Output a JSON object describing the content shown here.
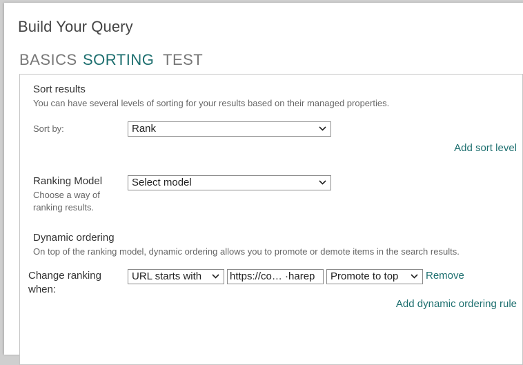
{
  "dialog": {
    "title": "Build Your Query"
  },
  "tabs": [
    {
      "label": "BASICS",
      "active": false
    },
    {
      "label": "SORTING",
      "active": true
    },
    {
      "label": "TEST",
      "active": false
    }
  ],
  "sort_results": {
    "heading": "Sort results",
    "description": "You can have several levels of sorting for your results based on their managed properties.",
    "sort_by_label": "Sort by:",
    "sort_by_value": "Rank",
    "add_sort_level": "Add sort level"
  },
  "ranking_model": {
    "heading": "Ranking Model",
    "description_line1": "Choose a way of",
    "description_line2": "ranking results.",
    "value": "Select model"
  },
  "dynamic_ordering": {
    "heading": "Dynamic ordering",
    "description": "On top of the ranking model, dynamic ordering allows you to promote or demote items in the search results.",
    "change_ranking_line1": "Change ranking",
    "change_ranking_line2": "when:",
    "condition_value": "URL starts with",
    "url_value": "https://co… ·harep",
    "action_value": "Promote to top",
    "remove_label": "Remove",
    "add_rule_label": "Add dynamic ordering rule"
  },
  "colors": {
    "accent": "#1d6f6f",
    "text": "#333333",
    "muted": "#666666",
    "border": "#8a8a8a"
  },
  "icons": {
    "dropdown": "chevron-down-icon"
  }
}
